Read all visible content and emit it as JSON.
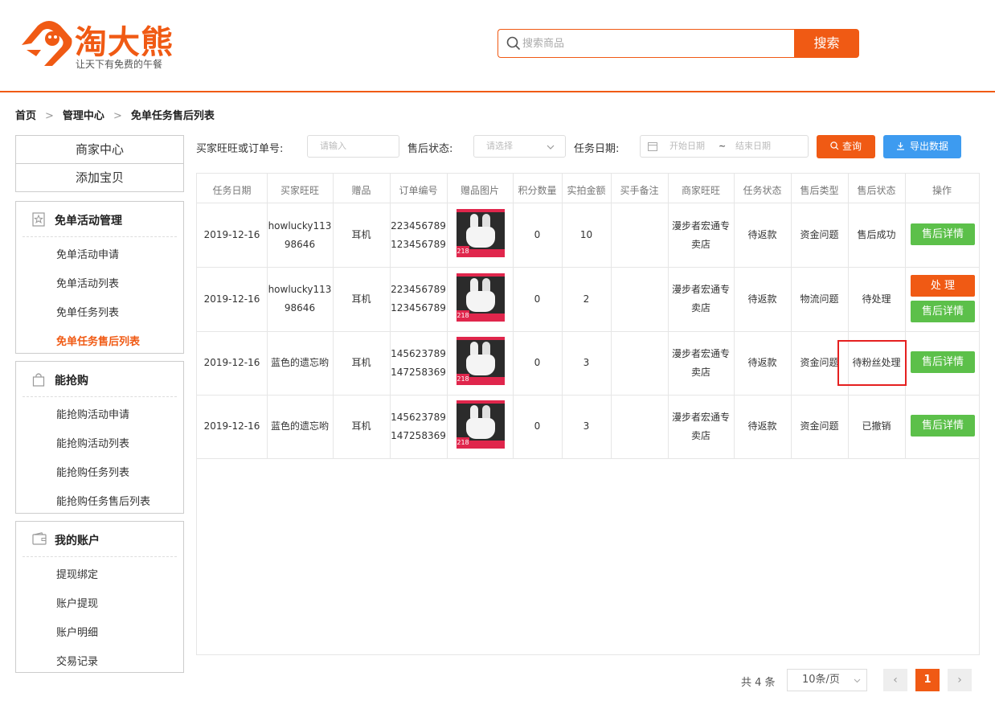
{
  "brand": {
    "name": "淘大熊",
    "slogan": "让天下有免费的午餐",
    "accent": "#f05a14"
  },
  "search": {
    "placeholder": "搜索商品",
    "button": "搜索"
  },
  "breadcrumb": [
    "首页",
    "管理中心",
    "免单任务售后列表"
  ],
  "sidebar": {
    "top": [
      "商家中心",
      "添加宝贝"
    ],
    "groups": [
      {
        "title": "免单活动管理",
        "icon": "star-badge-icon",
        "items": [
          "免单活动申请",
          "免单活动列表",
          "免单任务列表",
          "免单任务售后列表"
        ]
      },
      {
        "title": "能抢购",
        "icon": "shopping-bag-icon",
        "items": [
          "能抢购活动申请",
          "能抢购活动列表",
          "能抢购任务列表",
          "能抢购任务售后列表"
        ]
      },
      {
        "title": "我的账户",
        "icon": "wallet-icon",
        "items": [
          "提现绑定",
          "账户提现",
          "账户明细",
          "交易记录"
        ]
      }
    ],
    "active_item": "免单任务售后列表"
  },
  "filters": {
    "buyer_label": "买家旺旺或订单号:",
    "buyer_placeholder": "请输入",
    "status_label": "售后状态:",
    "status_placeholder": "请选择",
    "date_label": "任务日期:",
    "date_start_placeholder": "开始日期",
    "date_sep": "~",
    "date_end_placeholder": "结束日期",
    "query_button": "查询",
    "export_button": "导出数据"
  },
  "table": {
    "headers": [
      "任务日期",
      "买家旺旺",
      "赠品",
      "订单编号",
      "赠品图片",
      "积分数量",
      "实拍金额",
      "买手备注",
      "商家旺旺",
      "任务状态",
      "售后类型",
      "售后状态",
      "操作"
    ],
    "thumb_price": "218",
    "rows": [
      {
        "date": "2019-12-16",
        "buyer": [
          "howlucky113",
          "98646"
        ],
        "gift": "耳机",
        "order": [
          "223456789",
          "123456789"
        ],
        "points": "0",
        "amount": "10",
        "note": "",
        "shop": [
          "漫步者宏通专",
          "卖店"
        ],
        "task_status": "待返款",
        "type": "资金问题",
        "aftersale": "售后成功",
        "actions": [
          "售后详情"
        ]
      },
      {
        "date": "2019-12-16",
        "buyer": [
          "howlucky113",
          "98646"
        ],
        "gift": "耳机",
        "order": [
          "223456789",
          "123456789"
        ],
        "points": "0",
        "amount": "2",
        "note": "",
        "shop": [
          "漫步者宏通专",
          "卖店"
        ],
        "task_status": "待返款",
        "type": "物流问题",
        "aftersale": "待处理",
        "actions": [
          "处 理",
          "售后详情"
        ]
      },
      {
        "date": "2019-12-16",
        "buyer": [
          "蓝色的遗忘哟"
        ],
        "gift": "耳机",
        "order": [
          "145623789",
          "147258369"
        ],
        "points": "0",
        "amount": "3",
        "note": "",
        "shop": [
          "漫步者宏通专",
          "卖店"
        ],
        "task_status": "待返款",
        "type": "资金问题",
        "aftersale": "待粉丝处理",
        "actions": [
          "售后详情"
        ]
      },
      {
        "date": "2019-12-16",
        "buyer": [
          "蓝色的遗忘哟"
        ],
        "gift": "耳机",
        "order": [
          "145623789",
          "147258369"
        ],
        "points": "0",
        "amount": "3",
        "note": "",
        "shop": [
          "漫步者宏通专",
          "卖店"
        ],
        "task_status": "待返款",
        "type": "资金问题",
        "aftersale": "已撤销",
        "actions": [
          "售后详情"
        ]
      }
    ]
  },
  "pager": {
    "total": "共 4 条",
    "page_size": "10条/页",
    "current": "1",
    "prev": "‹",
    "next": "›"
  },
  "colors": {
    "green": "#5cc04a",
    "orange": "#f05a14",
    "blue": "#3d9bf0",
    "highlight": "#e52020"
  }
}
